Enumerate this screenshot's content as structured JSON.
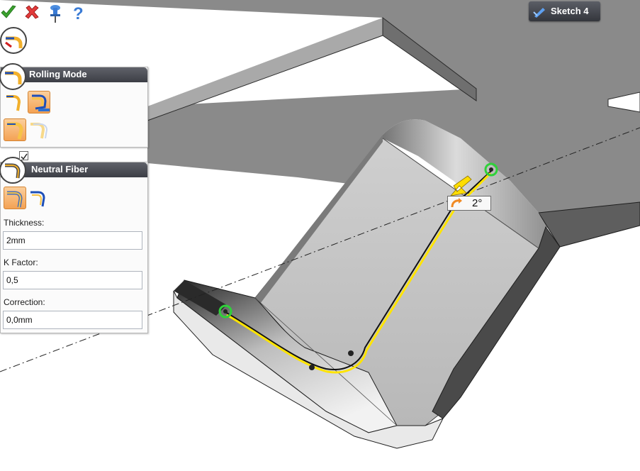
{
  "toolbar": {
    "items": [
      {
        "name": "ok-checkmark-icon",
        "color": "#3aa12e"
      },
      {
        "name": "cancel-x-icon",
        "color": "#d42a2a"
      },
      {
        "name": "pin-icon",
        "color": "#3a7bd5"
      },
      {
        "name": "help-question-icon",
        "color": "#3a7bd5"
      }
    ]
  },
  "sketch_tab": {
    "label": "Sketch 4",
    "icon": "sketch-pencil-icon"
  },
  "rolling_mode": {
    "title": "Rolling Mode",
    "options": [
      {
        "icon": "roll-inside-icon",
        "active": false
      },
      {
        "icon": "roll-outside-icon",
        "active": true
      },
      {
        "icon": "roll-both-icon",
        "active": true
      },
      {
        "icon": "roll-ghost-icon",
        "active": false
      }
    ]
  },
  "neutral_fiber": {
    "title": "Neutral Fiber",
    "options": [
      {
        "icon": "fiber-center-icon",
        "active": true
      },
      {
        "icon": "fiber-outer-icon",
        "active": false
      }
    ],
    "thickness_label": "Thickness:",
    "thickness_value": "2mm",
    "kfactor_label": "K Factor:",
    "kfactor_value": "0,5",
    "correction_label": "Correction:",
    "correction_value": "0,0mm"
  },
  "viewport": {
    "angle_label": "2°",
    "accent_color": "#ffe400",
    "handle_color": "#2fd13a",
    "part_color": "#8a8a8a"
  }
}
